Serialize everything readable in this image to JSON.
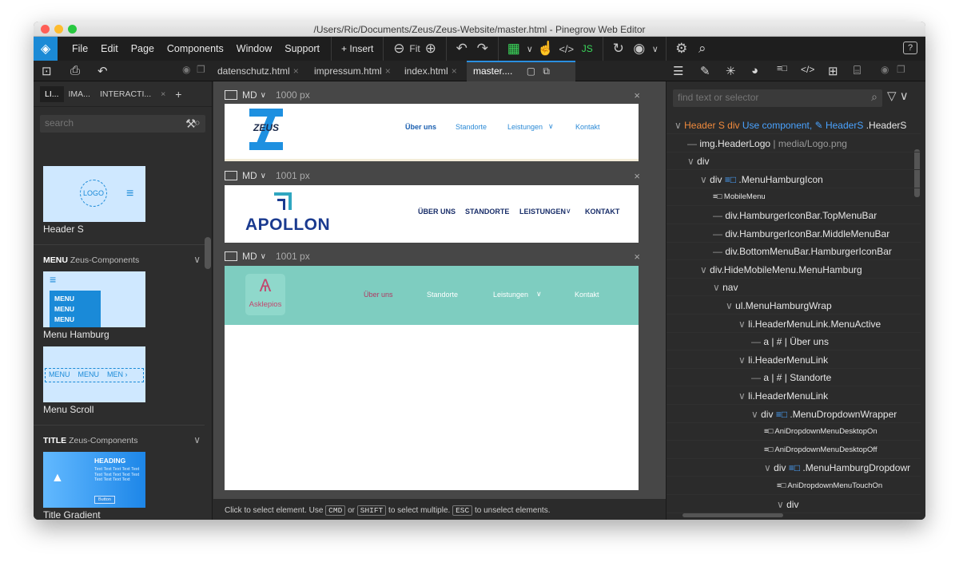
{
  "window": {
    "title": "/Users/Ric/Documents/Zeus/Zeus-Website/master.html - Pinegrow Web Editor"
  },
  "menubar": {
    "items": [
      "File",
      "Edit",
      "Page",
      "Components",
      "Window",
      "Support"
    ],
    "insert_label": "+ Insert",
    "fit_label": "Fit"
  },
  "tabs": {
    "files": [
      {
        "label": "datenschutz.html"
      },
      {
        "label": "impressum.html"
      },
      {
        "label": "index.html"
      },
      {
        "label": "master...."
      }
    ]
  },
  "left_panel": {
    "tabs": [
      "LI...",
      "IMA...",
      "INTERACTI..."
    ],
    "search_placeholder": "search",
    "components": [
      {
        "label": "Header S",
        "thumb_text": "LOGO"
      },
      {
        "label": "Menu Hamburg",
        "thumb_items": [
          "MENU",
          "MENU",
          "MENU"
        ]
      },
      {
        "label": "Menu Scroll",
        "thumb_items": [
          "MENU",
          "MENU",
          "MEN"
        ]
      },
      {
        "label": "Title Gradient",
        "thumb_heading": "HEADING",
        "thumb_body": "Text Text Text Text Text Text Text Text Text Text Text Text Text Text",
        "thumb_button": "Button"
      }
    ],
    "sections": [
      {
        "name": "MENU",
        "sub": "Zeus-Components"
      },
      {
        "name": "TITLE",
        "sub": "Zeus-Components"
      }
    ]
  },
  "viewports": [
    {
      "size": "MD",
      "width_label": "1000 px",
      "brand": "ZEUS",
      "nav": [
        "Über uns",
        "Standorte",
        "Leistungen",
        "Kontakt"
      ],
      "colors": {
        "logo": "#1e90e0",
        "nav": "#2b8ad6",
        "active": "#1a5fb0",
        "bg": "#ffffff"
      }
    },
    {
      "size": "MD",
      "width_label": "1001 px",
      "brand": "APOLLON",
      "nav": [
        "ÜBER UNS",
        "STANDORTE",
        "LEISTUNGEN",
        "KONTAKT"
      ],
      "colors": {
        "logo": "#1a3a8f",
        "accent": "#2fa6c0",
        "bg": "#ffffff"
      }
    },
    {
      "size": "MD",
      "width_label": "1001 px",
      "brand": "Asklepios",
      "nav": [
        "Über uns",
        "Standorte",
        "Leistungen",
        "Kontakt"
      ],
      "colors": {
        "bg": "#7ecdc0",
        "logo": "#c2476e",
        "nav_active": "#b03a63",
        "nav": "#ffffff"
      }
    }
  ],
  "status_bar": {
    "text1": "Click to select element. Use",
    "key1": "CMD",
    "text2": "or",
    "key2": "SHIFT",
    "text3": "to select multiple.",
    "key3": "ESC",
    "text4": "to unselect elements."
  },
  "right_panel": {
    "search_placeholder": "find text or selector",
    "tree": [
      {
        "depth": 0,
        "tag": "Header S div",
        "extra": "Use component,",
        "extra2": "HeaderS",
        "cls": ".HeaderS",
        "type": "component"
      },
      {
        "depth": 1,
        "text": "img.HeaderLogo",
        "dim": "| media/Logo.png"
      },
      {
        "depth": 1,
        "text": "div",
        "expand": true
      },
      {
        "depth": 2,
        "text": "div",
        "blue": "≡□",
        "cls": ".MenuHamburgIcon",
        "expand": true
      },
      {
        "depth": 3,
        "text": "≡□ MobileMenu",
        "small": true
      },
      {
        "depth": 3,
        "text": "div.HamburgerIconBar.TopMenuBar"
      },
      {
        "depth": 3,
        "text": "div.HamburgerIconBar.MiddleMenuBar"
      },
      {
        "depth": 3,
        "text": "div.BottomMenuBar.HamburgerIconBar"
      },
      {
        "depth": 2,
        "text": "div.HideMobileMenu.MenuHamburg",
        "expand": true
      },
      {
        "depth": 3,
        "text": "nav",
        "expand": true
      },
      {
        "depth": 4,
        "text": "ul.MenuHamburgWrap",
        "expand": true
      },
      {
        "depth": 5,
        "text": "li.HeaderMenuLink.MenuActive",
        "expand": true
      },
      {
        "depth": 6,
        "text": "a | # | Über uns"
      },
      {
        "depth": 5,
        "text": "li.HeaderMenuLink",
        "expand": true
      },
      {
        "depth": 6,
        "text": "a | # | Standorte"
      },
      {
        "depth": 5,
        "text": "li.HeaderMenuLink",
        "expand": true
      },
      {
        "depth": 6,
        "text": "div",
        "blue": "≡□",
        "cls": ".MenuDropdownWrapper",
        "expand": true
      },
      {
        "depth": 7,
        "text": "≡□ AniDropdownMenuDesktopOn",
        "small": true
      },
      {
        "depth": 7,
        "text": "≡□ AniDropdownMenuDesktopOff",
        "small": true
      },
      {
        "depth": 7,
        "text": "div",
        "blue": "≡□",
        "cls": ".MenuHamburgDropdowr",
        "expand": true
      },
      {
        "depth": 8,
        "text": "≡□ AniDropdownMenuTouchOn",
        "small": true
      },
      {
        "depth": 8,
        "text": "div",
        "expand": true
      }
    ]
  }
}
